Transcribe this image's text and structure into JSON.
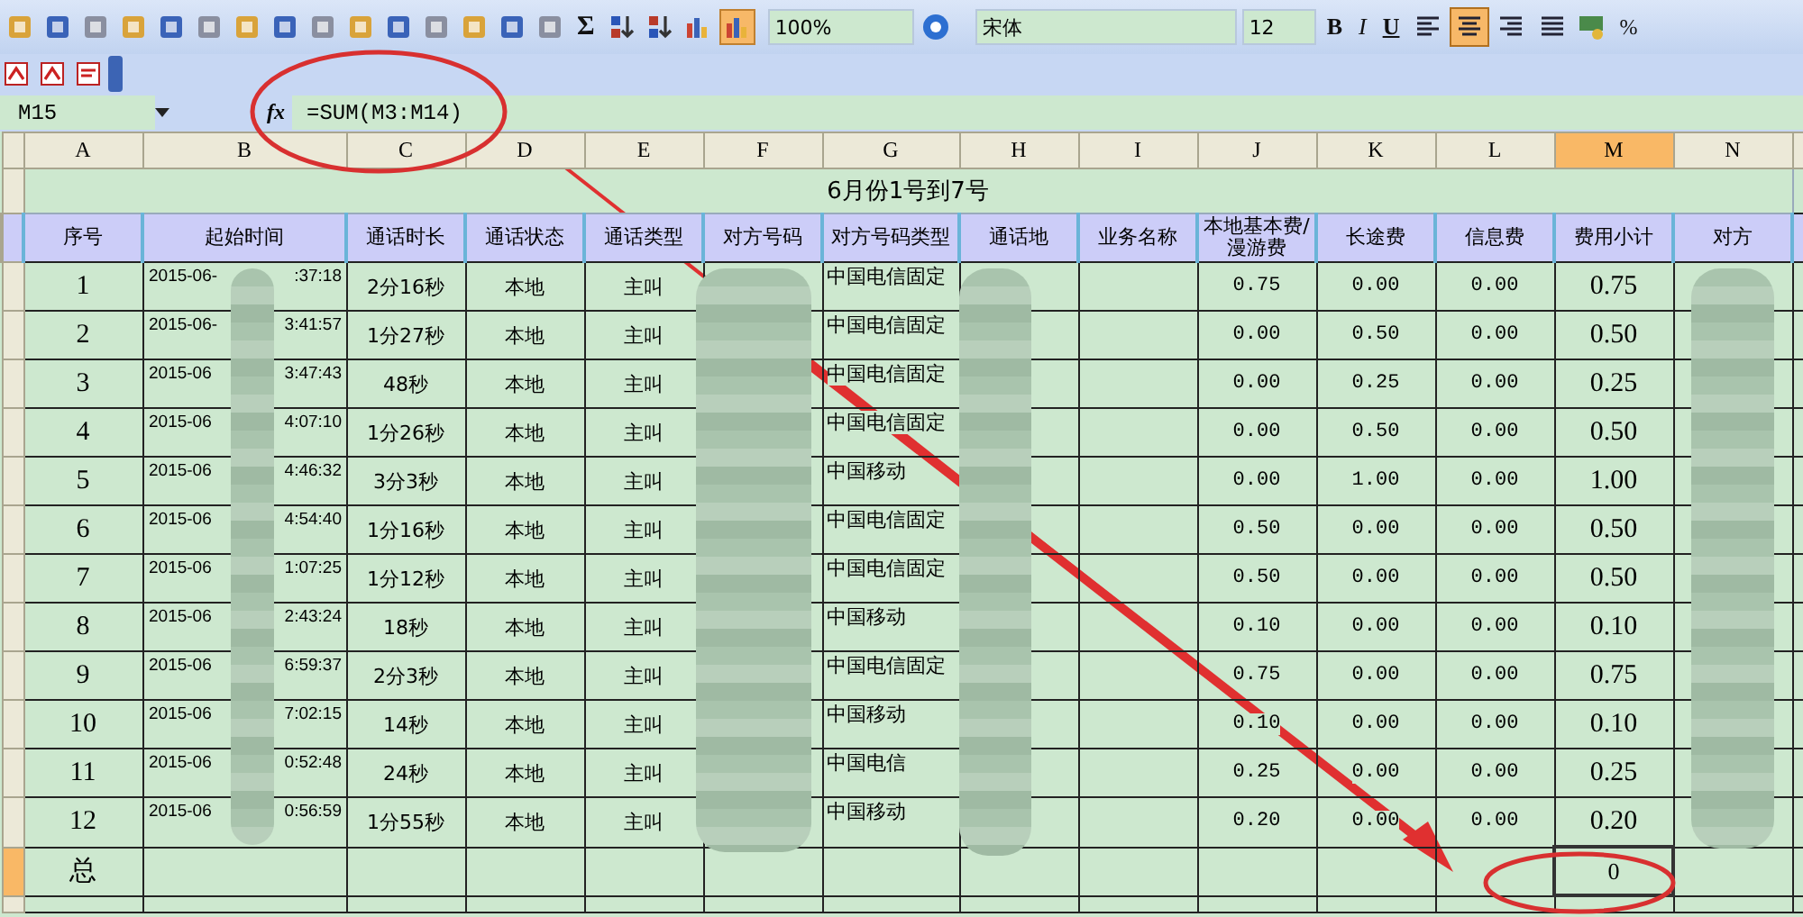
{
  "toolbar": {
    "zoom": "100%",
    "font": "宋体",
    "font_size": "12",
    "sum": "Σ",
    "bold": "B",
    "italic": "I",
    "underline": "U",
    "percent": "%",
    "align": [
      {
        "selected": false
      },
      {
        "selected": true
      },
      {
        "selected": false
      },
      {
        "selected": false
      }
    ]
  },
  "formula_bar": {
    "name_box": "M15",
    "fx": "fx",
    "formula": "=SUM(M3:M14)"
  },
  "columns": [
    {
      "label": "A",
      "selected": false
    },
    {
      "label": "B",
      "selected": false
    },
    {
      "label": "C",
      "selected": false
    },
    {
      "label": "D",
      "selected": false
    },
    {
      "label": "E",
      "selected": false
    },
    {
      "label": "F",
      "selected": false
    },
    {
      "label": "G",
      "selected": false
    },
    {
      "label": "H",
      "selected": false
    },
    {
      "label": "I",
      "selected": false
    },
    {
      "label": "J",
      "selected": false
    },
    {
      "label": "K",
      "selected": false
    },
    {
      "label": "L",
      "selected": false
    },
    {
      "label": "M",
      "selected": true
    },
    {
      "label": "N",
      "selected": false
    }
  ],
  "sheet": {
    "title": "6月份1号到7号",
    "headers": [
      "序号",
      "起始时间",
      "通话时长",
      "通话状态",
      "通话类型",
      "对方号码",
      "对方号码类型",
      "通话地",
      "业务名称",
      "本地基本费/漫游费",
      "长途费",
      "信息费",
      "费用小计",
      "对方"
    ],
    "rows": [
      {
        "index": "1",
        "date": "2015-06-",
        "time": ":37:18",
        "duration": "2分16秒",
        "status": "本地",
        "type": "主叫",
        "carrier": "中国电信固定",
        "base_fee": "0.75",
        "long_fee": "0.00",
        "info_fee": "0.00",
        "subtotal": "0.75"
      },
      {
        "index": "2",
        "date": "2015-06-",
        "time": "3:41:57",
        "duration": "1分27秒",
        "status": "本地",
        "type": "主叫",
        "carrier": "中国电信固定",
        "base_fee": "0.00",
        "long_fee": "0.50",
        "info_fee": "0.00",
        "subtotal": "0.50"
      },
      {
        "index": "3",
        "date": "2015-06",
        "time": "3:47:43",
        "duration": "48秒",
        "status": "本地",
        "type": "主叫",
        "carrier": "中国电信固定",
        "base_fee": "0.00",
        "long_fee": "0.25",
        "info_fee": "0.00",
        "subtotal": "0.25"
      },
      {
        "index": "4",
        "date": "2015-06",
        "time": "4:07:10",
        "duration": "1分26秒",
        "status": "本地",
        "type": "主叫",
        "carrier": "中国电信固定",
        "base_fee": "0.00",
        "long_fee": "0.50",
        "info_fee": "0.00",
        "subtotal": "0.50"
      },
      {
        "index": "5",
        "date": "2015-06",
        "time": "4:46:32",
        "duration": "3分3秒",
        "status": "本地",
        "type": "主叫",
        "carrier": "中国移动",
        "base_fee": "0.00",
        "long_fee": "1.00",
        "info_fee": "0.00",
        "subtotal": "1.00"
      },
      {
        "index": "6",
        "date": "2015-06",
        "time": "4:54:40",
        "duration": "1分16秒",
        "status": "本地",
        "type": "主叫",
        "carrier": "中国电信固定",
        "base_fee": "0.50",
        "long_fee": "0.00",
        "info_fee": "0.00",
        "subtotal": "0.50"
      },
      {
        "index": "7",
        "date": "2015-06",
        "time": "1:07:25",
        "duration": "1分12秒",
        "status": "本地",
        "type": "主叫",
        "carrier": "中国电信固定",
        "base_fee": "0.50",
        "long_fee": "0.00",
        "info_fee": "0.00",
        "subtotal": "0.50"
      },
      {
        "index": "8",
        "date": "2015-06",
        "time": "2:43:24",
        "duration": "18秒",
        "status": "本地",
        "type": "主叫",
        "carrier": "中国移动",
        "base_fee": "0.10",
        "long_fee": "0.00",
        "info_fee": "0.00",
        "subtotal": "0.10"
      },
      {
        "index": "9",
        "date": "2015-06",
        "time": "6:59:37",
        "duration": "2分3秒",
        "status": "本地",
        "type": "主叫",
        "carrier": "中国电信固定",
        "base_fee": "0.75",
        "long_fee": "0.00",
        "info_fee": "0.00",
        "subtotal": "0.75"
      },
      {
        "index": "10",
        "date": "2015-06",
        "time": "7:02:15",
        "duration": "14秒",
        "status": "本地",
        "type": "主叫",
        "carrier": "中国移动",
        "base_fee": "0.10",
        "long_fee": "0.00",
        "info_fee": "0.00",
        "subtotal": "0.10"
      },
      {
        "index": "11",
        "date": "2015-06",
        "time": "0:52:48",
        "duration": "24秒",
        "status": "本地",
        "type": "主叫",
        "carrier": "中国电信",
        "base_fee": "0.25",
        "long_fee": "0.00",
        "info_fee": "0.00",
        "subtotal": "0.25"
      },
      {
        "index": "12",
        "date": "2015-06",
        "time": "0:56:59",
        "duration": "1分55秒",
        "status": "本地",
        "type": "主叫",
        "carrier": "中国移动",
        "base_fee": "0.20",
        "long_fee": "0.00",
        "info_fee": "0.00",
        "subtotal": "0.20"
      }
    ],
    "total": {
      "label": "总",
      "value": "0",
      "selected": true
    }
  }
}
